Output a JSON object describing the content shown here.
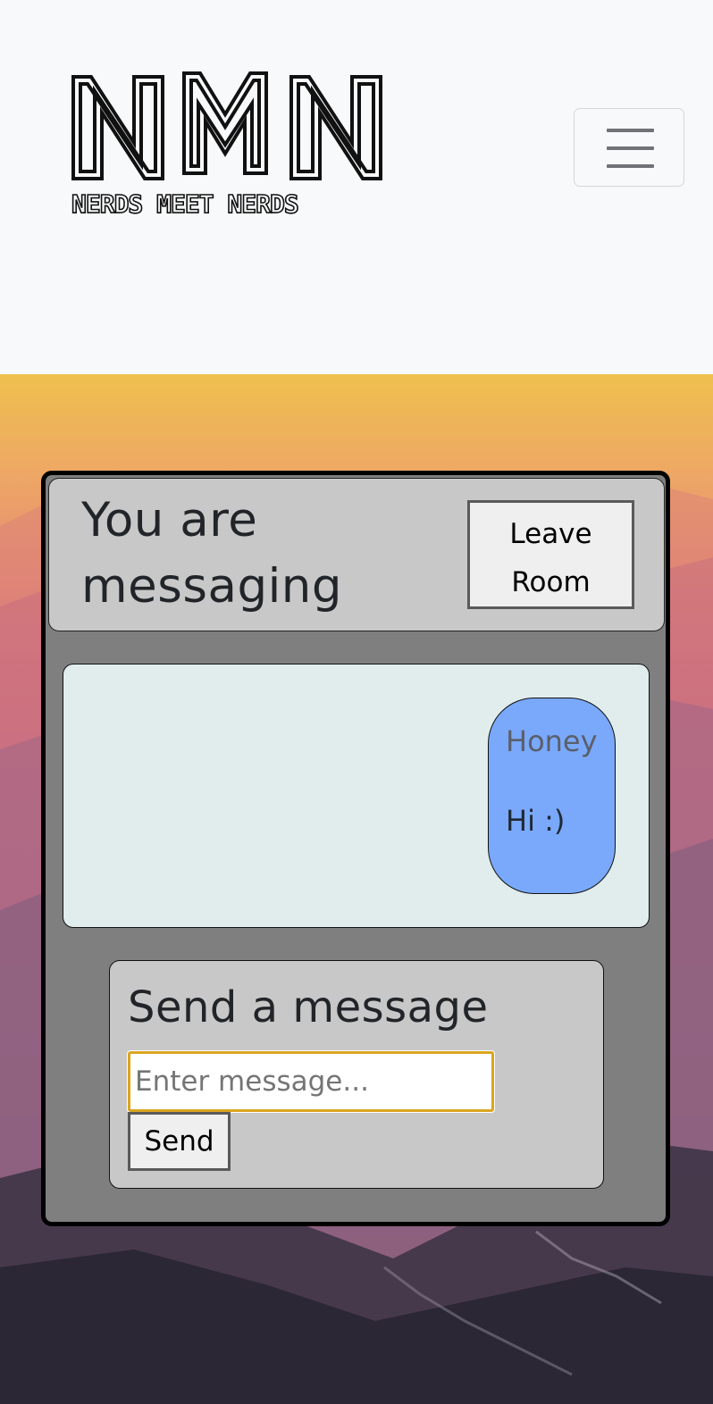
{
  "navbar": {
    "logo": {
      "letters": "NMN",
      "tagline": "NERDS MEET NERDS"
    },
    "toggler_icon": "hamburger-menu-icon"
  },
  "chat": {
    "title": "You are messaging",
    "leave_button_label": "Leave Room",
    "messages": [
      {
        "sender": "Honey",
        "text": "Hi :)"
      }
    ],
    "composer": {
      "title": "Send a message",
      "input_placeholder": "Enter message...",
      "input_value": "",
      "send_button_label": "Send"
    }
  },
  "colors": {
    "bubble": "#7aa9fb",
    "chat_panel": "#7f7f7f",
    "header_panel": "#c8c8c8",
    "message_area": "#e1eded",
    "input_focus_border": "#daa520"
  }
}
